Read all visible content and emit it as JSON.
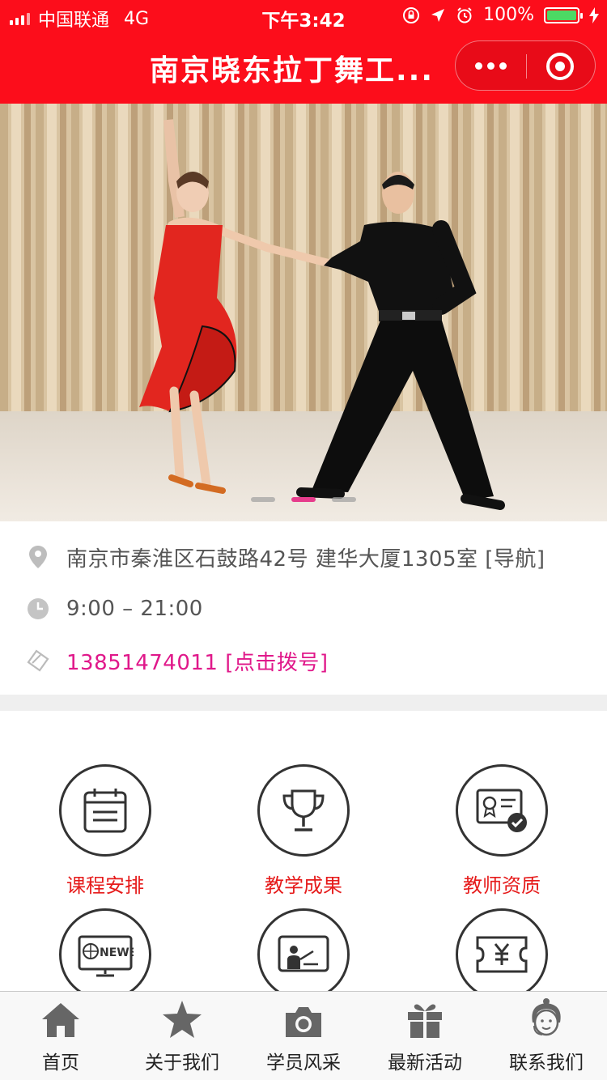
{
  "status_bar": {
    "carrier": "中国联通",
    "network": "4G",
    "time": "下午3:42",
    "battery": "100%",
    "battery_level": 1.0
  },
  "header": {
    "title": "南京晓东拉丁舞工..."
  },
  "banner": {
    "slide_count": 3,
    "active_index": 1
  },
  "info": {
    "address": "南京市秦淮区石鼓路42号 建华大厦1305室 [导航]",
    "hours": "9:00 – 21:00",
    "phone": "13851474011 [点击拨号]"
  },
  "grid": {
    "items": [
      {
        "label": "课程安排",
        "icon": "calendar-icon"
      },
      {
        "label": "教学成果",
        "icon": "trophy-icon"
      },
      {
        "label": "教师资质",
        "icon": "certificate-icon"
      },
      {
        "label": "",
        "icon": "news-icon"
      },
      {
        "label": "",
        "icon": "teaching-board-icon"
      },
      {
        "label": "",
        "icon": "yuan-ticket-icon"
      }
    ]
  },
  "tabbar": {
    "items": [
      {
        "label": "首页",
        "icon": "home-icon"
      },
      {
        "label": "关于我们",
        "icon": "star-icon"
      },
      {
        "label": "学员风采",
        "icon": "camera-icon"
      },
      {
        "label": "最新活动",
        "icon": "gift-icon"
      },
      {
        "label": "联系我们",
        "icon": "customer-service-icon"
      }
    ]
  },
  "colors": {
    "brand_red": "#fc0d1b",
    "grid_label": "#e61b1b",
    "phone_pink": "#e0188a",
    "dot_active": "#e63c8c"
  }
}
